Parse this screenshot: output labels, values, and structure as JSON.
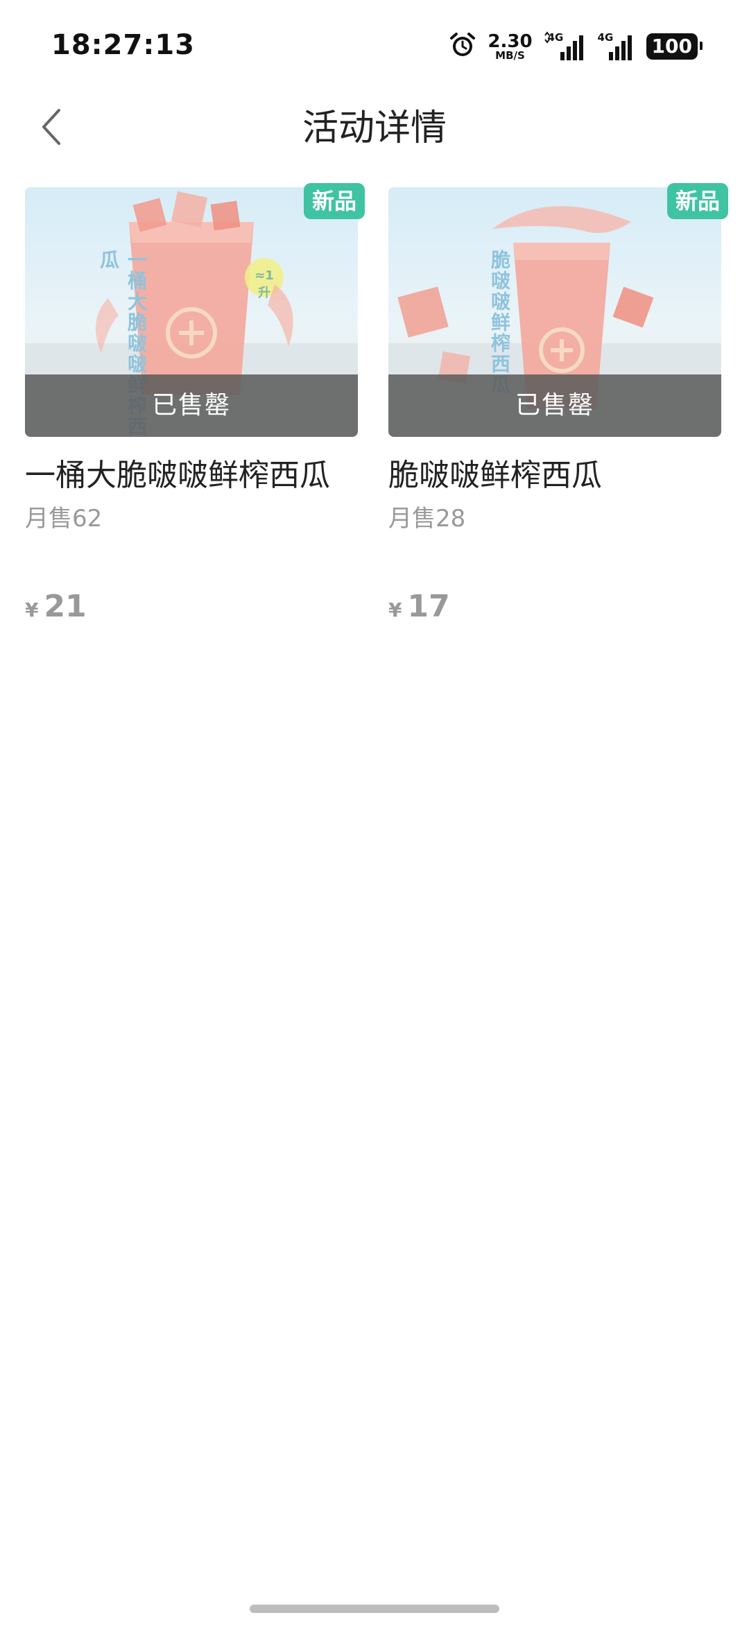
{
  "status_bar": {
    "time": "18:27:13",
    "net_speed_value": "2.30",
    "net_speed_unit": "MB/S",
    "signal1_label": "4G",
    "signal2_label": "4G",
    "battery": "100",
    "icons": [
      "alarm-icon",
      "signal-icon",
      "signal-icon",
      "battery-icon"
    ]
  },
  "nav": {
    "title": "活动详情",
    "back_icon": "chevron-left-icon"
  },
  "products": [
    {
      "name": "一桶大脆啵啵鲜榨西瓜",
      "sales": "月售62",
      "currency": "¥",
      "price": "21",
      "badge": "新品",
      "status": "已售罄",
      "image_vertical_text": "一桶大脆啵啵鲜榨西瓜",
      "sticker_text": "≈1升"
    },
    {
      "name": "脆啵啵鲜榨西瓜",
      "sales": "月售28",
      "currency": "¥",
      "price": "17",
      "badge": "新品",
      "status": "已售罄",
      "image_vertical_text": "脆啵啵鲜榨西瓜"
    }
  ],
  "colors": {
    "badge": "#3fc3a3",
    "soldout_overlay": "#5a5a5a",
    "muted_text": "#999999",
    "title_text": "#222222"
  }
}
